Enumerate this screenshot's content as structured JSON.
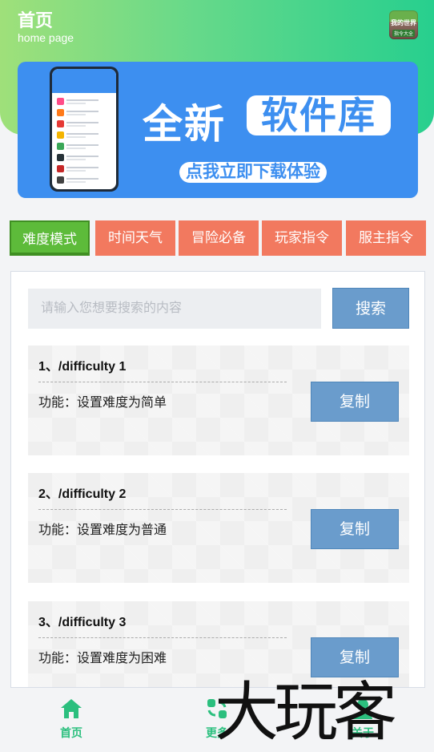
{
  "header": {
    "title": "首页",
    "subtitle": "home page",
    "app_icon_text": "我的世界",
    "app_icon_subtext": "指令大全"
  },
  "banner": {
    "line1": "全新",
    "line1_pill": "软件库",
    "cta": "点我立即下载体验"
  },
  "tabs": [
    {
      "label": "难度模式",
      "active": true
    },
    {
      "label": "时间天气",
      "active": false
    },
    {
      "label": "冒险必备",
      "active": false
    },
    {
      "label": "玩家指令",
      "active": false
    },
    {
      "label": "服主指令",
      "active": false
    }
  ],
  "search": {
    "placeholder": "请输入您想要搜索的内容",
    "button_label": "搜索"
  },
  "commands": [
    {
      "title": "1、/difficulty 1",
      "desc": "功能：设置难度为简单",
      "copy_label": "复制"
    },
    {
      "title": "2、/difficulty 2",
      "desc": "功能：设置难度为普通",
      "copy_label": "复制"
    },
    {
      "title": "3、/difficulty 3",
      "desc": "功能：设置难度为困难",
      "copy_label": "复制"
    }
  ],
  "bottom_nav": [
    {
      "label": "首页",
      "icon": "home-icon"
    },
    {
      "label": "更多",
      "icon": "more-icon"
    },
    {
      "label": "关于",
      "icon": "user-icon"
    }
  ],
  "watermark": "大玩客",
  "colors": {
    "accent_green": "#2bbf7e",
    "tab_orange": "#f2795f",
    "tab_active": "#5dbb3a",
    "button_blue": "#6a9ccc",
    "banner_blue": "#3d8ff0"
  }
}
